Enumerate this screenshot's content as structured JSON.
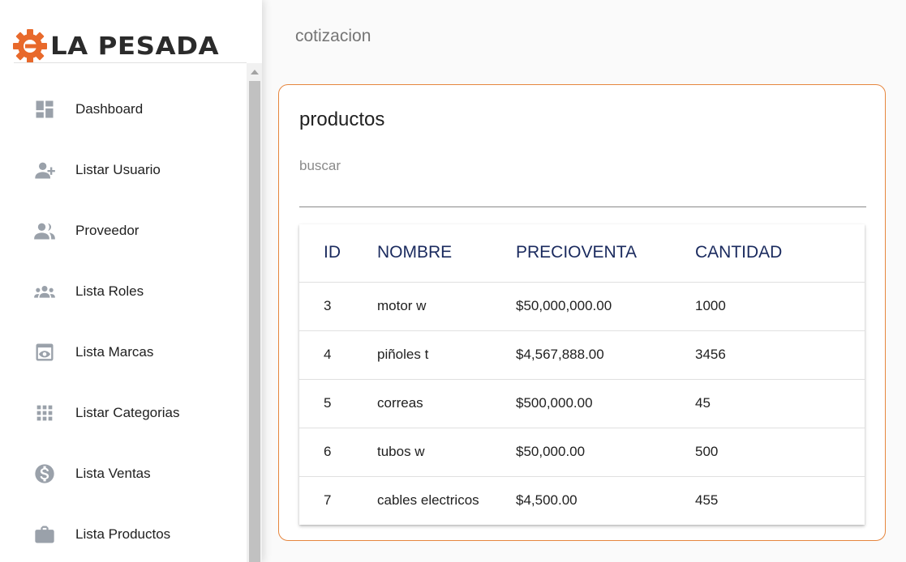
{
  "brand": {
    "name": "LA PESADA",
    "accent_color": "#e8692b",
    "icon": "gear-icon"
  },
  "sidebar": {
    "items": [
      {
        "label": "Dashboard",
        "icon": "dashboard-icon"
      },
      {
        "label": "Listar Usuario",
        "icon": "person-add-icon"
      },
      {
        "label": "Proveedor",
        "icon": "people-icon"
      },
      {
        "label": "Lista Roles",
        "icon": "groups-icon"
      },
      {
        "label": "Lista Marcas",
        "icon": "preview-icon"
      },
      {
        "label": "Listar Categorias",
        "icon": "grid-icon"
      },
      {
        "label": "Lista Ventas",
        "icon": "dollar-icon"
      },
      {
        "label": "Lista Productos",
        "icon": "briefcase-icon"
      }
    ]
  },
  "header": {
    "title": "cotizacion"
  },
  "card": {
    "title": "productos",
    "border_color": "#e6863e",
    "search": {
      "placeholder": "buscar",
      "value": ""
    },
    "table": {
      "columns": [
        "ID",
        "NOMBRE",
        "PRECIOVENTA",
        "CANTIDAD"
      ],
      "rows": [
        {
          "id": "3",
          "nombre": "motor w",
          "precio": "$50,000,000.00",
          "cantidad": "1000"
        },
        {
          "id": "4",
          "nombre": "piñoles t",
          "precio": "$4,567,888.00",
          "cantidad": "3456"
        },
        {
          "id": "5",
          "nombre": "correas",
          "precio": "$500,000.00",
          "cantidad": "45"
        },
        {
          "id": "6",
          "nombre": "tubos w",
          "precio": "$50,000.00",
          "cantidad": "500"
        },
        {
          "id": "7",
          "nombre": "cables electricos",
          "precio": "$4,500.00",
          "cantidad": "455"
        }
      ]
    }
  }
}
